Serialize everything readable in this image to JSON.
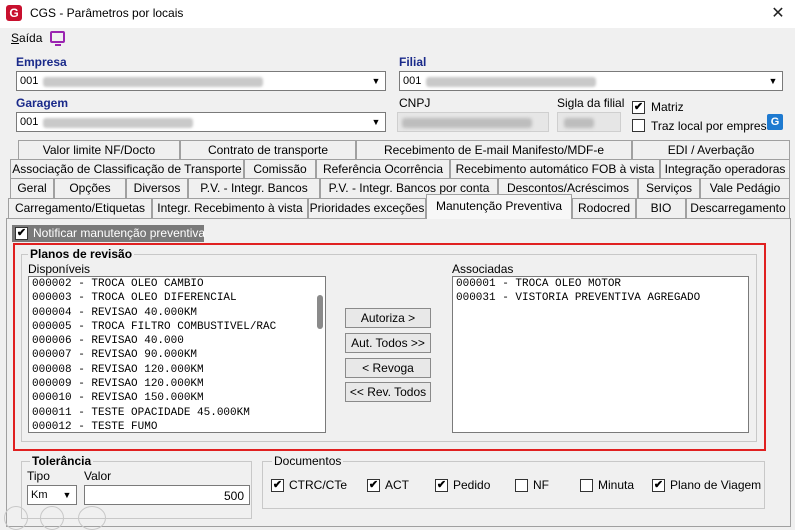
{
  "window": {
    "title": "CGS - Parâmetros por locais",
    "close_glyph": "✕",
    "app_icon_letter": "G"
  },
  "menu": {
    "saida_prefix": "S",
    "saida_rest": "aída"
  },
  "fields": {
    "empresa_label": "Empresa",
    "empresa_value": "001",
    "filial_label": "Filial",
    "filial_value": "001",
    "garagem_label": "Garagem",
    "garagem_value": "001",
    "cnpj_label": "CNPJ",
    "sigla_label": "Sigla da filial",
    "matriz_label": "Matriz",
    "matriz_checked": true,
    "traz_local_label": "Traz local por empresa",
    "traz_local_checked": false
  },
  "tabs": {
    "row1": [
      "Valor limite NF/Docto",
      "Contrato de transporte",
      "Recebimento de E-mail Manifesto/MDF-e",
      "EDI / Averbação"
    ],
    "row2": [
      "Associação de Classificação de Transporte",
      "Comissão",
      "Referência Ocorrência",
      "Recebimento automático FOB à vista",
      "Integração operadoras"
    ],
    "row3": [
      "Geral",
      "Opções",
      "Diversos",
      "P.V. - Integr. Bancos",
      "P.V. - Integr. Bancos por conta",
      "Descontos/Acréscimos",
      "Serviços",
      "Vale Pedágio"
    ],
    "row4": [
      "Carregamento/Etiquetas",
      "Integr. Recebimento à vista",
      "Prioridades exceções",
      "Manutenção Preventiva",
      "Rodocred",
      "BIO",
      "Descarregamento"
    ],
    "active": "Manutenção Preventiva"
  },
  "manutencao": {
    "notificar_label": "Notificar manutenção preventiva",
    "notificar_checked": true,
    "planos_title": "Planos de revisão",
    "disponiveis_label": "Disponíveis",
    "associadas_label": "Associadas",
    "disponiveis": [
      "000002 - TROCA OLEO CAMBIO",
      "000003 - TROCA OLEO DIFERENCIAL",
      "000004 - REVISAO 40.000KM",
      "000005 - TROCA FILTRO COMBUSTIVEL/RAC",
      "000006 - REVISAO 40.000",
      "000007 - REVISAO 90.000KM",
      "000008 - REVISAO 120.000KM",
      "000009 - REVISAO 120.000KM",
      "000010 - REVISAO 150.000KM",
      "000011 - TESTE OPACIDADE 45.000KM",
      "000012 - TESTE FUMO"
    ],
    "associadas": [
      "000001 - TROCA OLEO MOTOR",
      "000031 - VISTORIA PREVENTIVA AGREGADO"
    ],
    "buttons": {
      "autoriza": "Autoriza >",
      "aut_todos": "Aut. Todos >>",
      "revoga": "< Revoga",
      "rev_todos": "<< Rev. Todos"
    }
  },
  "tolerancia": {
    "title": "Tolerância",
    "tipo_label": "Tipo",
    "valor_label": "Valor",
    "tipo_value": "Km",
    "valor_value": "500"
  },
  "documentos": {
    "title": "Documentos",
    "items": [
      {
        "label": "CTRC/CTe",
        "checked": true
      },
      {
        "label": "ACT",
        "checked": true
      },
      {
        "label": "Pedido",
        "checked": true
      },
      {
        "label": "NF",
        "checked": false
      },
      {
        "label": "Minuta",
        "checked": false
      },
      {
        "label": "Plano de Viagem",
        "checked": true
      }
    ]
  },
  "colors": {
    "highlight": "#e02020",
    "label_blue": "#1a2a8a",
    "brand_red": "#c8102e"
  }
}
